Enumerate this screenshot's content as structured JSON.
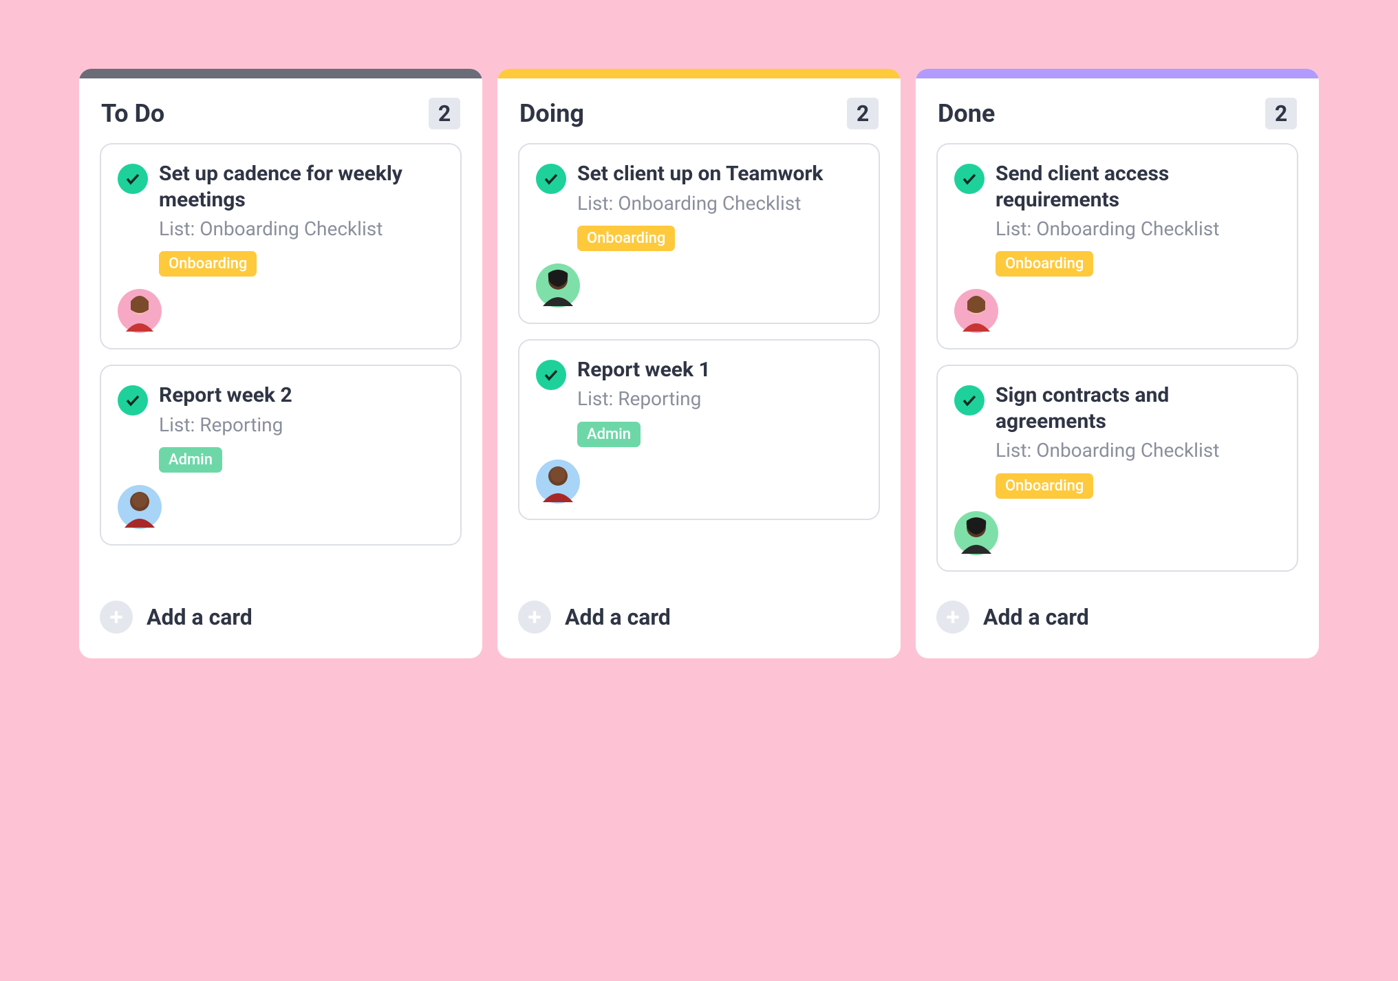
{
  "colors": {
    "stripe_todo": "#6a6d78",
    "stripe_doing": "#ffc93c",
    "stripe_done": "#b29bff",
    "tag_onboarding": "#ffc93c",
    "tag_admin": "#6ed7a8"
  },
  "add_card_label": "Add a card",
  "columns": [
    {
      "title": "To Do",
      "count": "2",
      "stripe": "stripe_todo",
      "cards": [
        {
          "title": "Set up cadence for weekly meetings",
          "list": "List: Onboarding Checklist",
          "tag": "Onboarding",
          "tag_color": "tag_onboarding",
          "avatar": "person-a"
        },
        {
          "title": "Report week 2",
          "list": "List: Reporting",
          "tag": "Admin",
          "tag_color": "tag_admin",
          "avatar": "person-c"
        }
      ]
    },
    {
      "title": "Doing",
      "count": "2",
      "stripe": "stripe_doing",
      "cards": [
        {
          "title": "Set client up on Teamwork",
          "list": "List: Onboarding Checklist",
          "tag": "Onboarding",
          "tag_color": "tag_onboarding",
          "avatar": "person-b"
        },
        {
          "title": "Report week 1",
          "list": "List: Reporting",
          "tag": "Admin",
          "tag_color": "tag_admin",
          "avatar": "person-c"
        }
      ]
    },
    {
      "title": "Done",
      "count": "2",
      "stripe": "stripe_done",
      "cards": [
        {
          "title": "Send client access requirements",
          "list": "List: Onboarding Checklist",
          "tag": "Onboarding",
          "tag_color": "tag_onboarding",
          "avatar": "person-a"
        },
        {
          "title": "Sign contracts and agreements",
          "list": "List: Onboarding Checklist",
          "tag": "Onboarding",
          "tag_color": "tag_onboarding",
          "avatar": "person-b"
        }
      ]
    }
  ]
}
